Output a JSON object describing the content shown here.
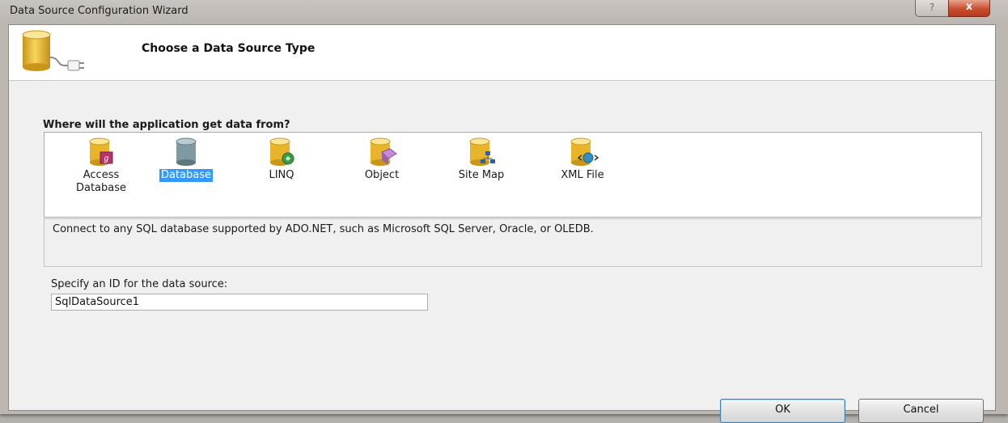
{
  "window": {
    "title": "Data Source Configuration Wizard",
    "help_glyph": "?",
    "close_glyph": "x"
  },
  "header": {
    "title": "Choose a Data Source Type",
    "icon": "database-plug-icon"
  },
  "source_types": {
    "label": "Where will the application get data from?",
    "selected": "Database",
    "items": [
      {
        "label": "Access\nDatabase",
        "icon": "access-database-icon"
      },
      {
        "label": "Database",
        "icon": "database-icon"
      },
      {
        "label": "LINQ",
        "icon": "linq-icon"
      },
      {
        "label": "Object",
        "icon": "object-icon"
      },
      {
        "label": "Site Map",
        "icon": "site-map-icon"
      },
      {
        "label": "XML File",
        "icon": "xml-file-icon"
      }
    ]
  },
  "description": "Connect to any SQL database supported by ADO.NET, such as Microsoft SQL Server, Oracle, or OLEDB.",
  "id_field": {
    "label": "Specify an ID for the data source:",
    "value": "SqlDataSource1"
  },
  "buttons": {
    "ok": "OK",
    "cancel": "Cancel"
  },
  "colors": {
    "selection": "#3399ff",
    "cylinder_gold": "#e8b52a",
    "cylinder_gray": "#7f9aa3"
  }
}
